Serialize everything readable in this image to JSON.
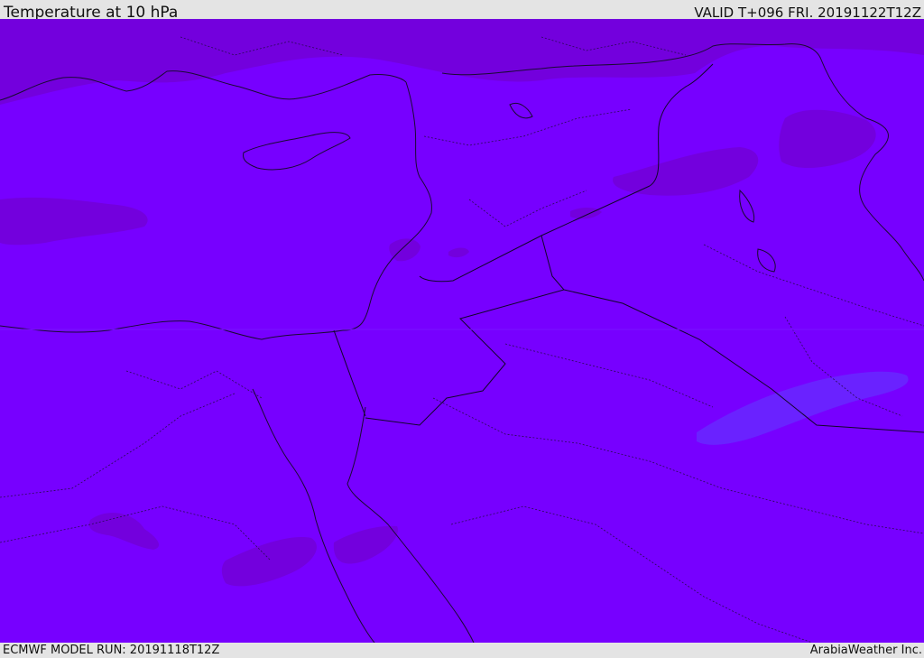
{
  "header": {
    "title": "Temperature at 10 hPa",
    "valid": "VALID T+096 FRI. 20191122T12Z"
  },
  "footer": {
    "model_run": "ECMWF MODEL RUN: 20191118T12Z",
    "credit": "ArabiaWeather Inc."
  },
  "map": {
    "colors": {
      "background_field": "#7700ff",
      "warm_patch": "#7300dd",
      "cool_patch": "#6a22ff",
      "coastline": "#1a0a33",
      "border": "#2a0a55"
    }
  }
}
